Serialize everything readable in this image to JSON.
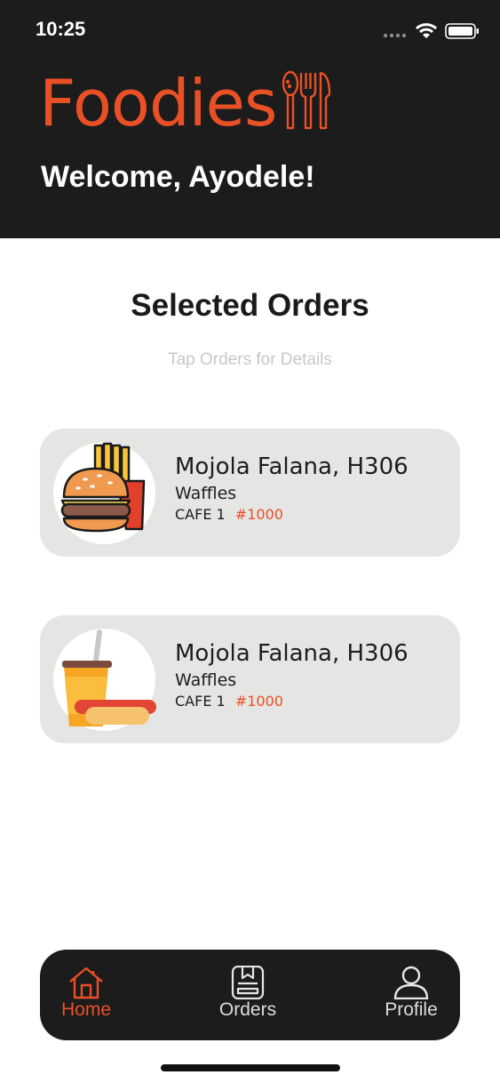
{
  "status_bar": {
    "time": "10:25"
  },
  "header": {
    "brand": "Foodies",
    "brand_icon": "utensils-icon",
    "welcome": "Welcome, Ayodele!"
  },
  "section": {
    "title": "Selected Orders",
    "subtitle": "Tap Orders for Details"
  },
  "orders": [
    {
      "name": "Mojola Falana, H306",
      "item": "Waffles",
      "cafe": "CAFE 1",
      "number": "#1000",
      "image": "burger-fries-icon"
    },
    {
      "name": "Mojola Falana, H306",
      "item": "Waffles",
      "cafe": "CAFE 1",
      "number": "#1000",
      "image": "drink-hotdog-icon"
    }
  ],
  "tabbar": {
    "tabs": [
      {
        "label": "Home",
        "icon": "home-icon",
        "active": true
      },
      {
        "label": "Orders",
        "icon": "orders-icon",
        "active": false
      },
      {
        "label": "Profile",
        "icon": "profile-icon",
        "active": false
      }
    ]
  },
  "colors": {
    "accent": "#ea5026",
    "header_bg": "#1c1c1c",
    "card_bg": "#e5e6e3"
  }
}
